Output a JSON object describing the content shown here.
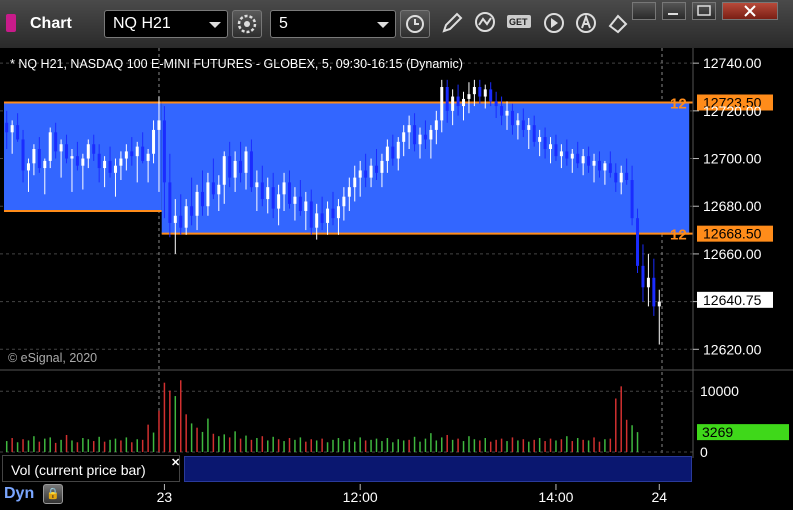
{
  "window": {
    "title": "Chart"
  },
  "toolbar": {
    "symbol": "NQ H21",
    "interval": "5",
    "icons": [
      "settings-gear-icon",
      "clock-icon",
      "pencil-draw-icon",
      "study-icon",
      "get-icon",
      "play-icon",
      "alert-icon",
      "cursor-icon"
    ],
    "window_controls": [
      "restore-icon",
      "minimize-icon",
      "maximize-icon",
      "close-icon"
    ]
  },
  "colors": {
    "background": "#000000",
    "zone_fill": "#3366ff",
    "zone_border": "#ff8c1a",
    "up_bar": "#ffffff",
    "down_bar": "#1a2cff",
    "vol_up": "#3fb83f",
    "vol_down": "#d23030",
    "last_price_bg": "#ffffff",
    "vol_last_bg": "#3fd81a"
  },
  "chart_data": {
    "type": "candlestick",
    "title": "* NQ H21, NASDAQ 100 E-MINI FUTURES - GLOBEX, 5, 09:30-16:15 (Dynamic)",
    "copyright": "© eSignal, 2020",
    "price_axis": {
      "ylim": [
        12613,
        12743
      ],
      "ticks": [
        12620.0,
        12640.0,
        12660.0,
        12680.0,
        12700.0,
        12720.0,
        12740.0
      ],
      "tick_labels": [
        "12620.00",
        "12640.00",
        "12660.00",
        "12680.00",
        "12700.00",
        "12720.00",
        "12740.00"
      ]
    },
    "x_axis": {
      "tick_labels": [
        "23",
        "12:00",
        "14:00",
        "24"
      ]
    },
    "zones": [
      {
        "upper": 12723.5,
        "lower": 12678.0,
        "start_bar": 0,
        "end_bar": 28
      },
      {
        "upper": 12723.5,
        "lower": 12668.5,
        "start_bar": 29,
        "end_bar": 125
      }
    ],
    "price_lines": [
      {
        "value": 12723.5,
        "label": "12723.50",
        "tag": "12"
      },
      {
        "value": 12668.5,
        "label": "12668.50",
        "tag": "12"
      }
    ],
    "last_price": {
      "value": 12640.75,
      "label": "12640.75"
    },
    "candles": [
      [
        12715,
        12720,
        12704,
        12711
      ],
      [
        12711,
        12716,
        12702,
        12714
      ],
      [
        12714,
        12719,
        12707,
        12708
      ],
      [
        12708,
        12712,
        12690,
        12695
      ],
      [
        12695,
        12700,
        12686,
        12698
      ],
      [
        12698,
        12706,
        12693,
        12704
      ],
      [
        12704,
        12709,
        12694,
        12696
      ],
      [
        12696,
        12700,
        12685,
        12699
      ],
      [
        12699,
        12713,
        12696,
        12711
      ],
      [
        12711,
        12715,
        12700,
        12703
      ],
      [
        12703,
        12708,
        12692,
        12706
      ],
      [
        12706,
        12710,
        12698,
        12700
      ],
      [
        12700,
        12704,
        12686,
        12701
      ],
      [
        12701,
        12707,
        12695,
        12697
      ],
      [
        12697,
        12702,
        12687,
        12700
      ],
      [
        12700,
        12708,
        12696,
        12706
      ],
      [
        12706,
        12710,
        12699,
        12702
      ],
      [
        12702,
        12706,
        12690,
        12696
      ],
      [
        12696,
        12701,
        12688,
        12699
      ],
      [
        12699,
        12705,
        12692,
        12694
      ],
      [
        12694,
        12700,
        12684,
        12697
      ],
      [
        12697,
        12703,
        12691,
        12700
      ],
      [
        12700,
        12706,
        12695,
        12703
      ],
      [
        12703,
        12709,
        12697,
        12701
      ],
      [
        12701,
        12707,
        12690,
        12705
      ],
      [
        12705,
        12711,
        12698,
        12699
      ],
      [
        12699,
        12704,
        12690,
        12702
      ],
      [
        12702,
        12716,
        12698,
        12712
      ],
      [
        12712,
        12726,
        12686,
        12716
      ],
      [
        12716,
        12722,
        12675,
        12690
      ],
      [
        12690,
        12702,
        12667,
        12673
      ],
      [
        12673,
        12683,
        12660,
        12676
      ],
      [
        12676,
        12685,
        12668,
        12671
      ],
      [
        12671,
        12683,
        12668,
        12680
      ],
      [
        12680,
        12692,
        12672,
        12676
      ],
      [
        12676,
        12689,
        12670,
        12686
      ],
      [
        12686,
        12695,
        12676,
        12680
      ],
      [
        12680,
        12694,
        12676,
        12690
      ],
      [
        12690,
        12700,
        12683,
        12685
      ],
      [
        12685,
        12693,
        12678,
        12689
      ],
      [
        12689,
        12703,
        12681,
        12701
      ],
      [
        12701,
        12707,
        12688,
        12692
      ],
      [
        12692,
        12703,
        12686,
        12699
      ],
      [
        12699,
        12707,
        12690,
        12694
      ],
      [
        12694,
        12705,
        12687,
        12703
      ],
      [
        12703,
        12708,
        12686,
        12688
      ],
      [
        12688,
        12695,
        12678,
        12690
      ],
      [
        12690,
        12697,
        12680,
        12683
      ],
      [
        12683,
        12692,
        12677,
        12688
      ],
      [
        12688,
        12694,
        12675,
        12679
      ],
      [
        12679,
        12689,
        12672,
        12685
      ],
      [
        12685,
        12694,
        12678,
        12690
      ],
      [
        12690,
        12695,
        12679,
        12681
      ],
      [
        12681,
        12688,
        12674,
        12684
      ],
      [
        12684,
        12691,
        12676,
        12678
      ],
      [
        12678,
        12686,
        12670,
        12682
      ],
      [
        12682,
        12687,
        12668,
        12671
      ],
      [
        12671,
        12681,
        12666,
        12677
      ],
      [
        12677,
        12684,
        12670,
        12673
      ],
      [
        12673,
        12682,
        12668,
        12679
      ],
      [
        12679,
        12686,
        12672,
        12675
      ],
      [
        12675,
        12683,
        12668,
        12680
      ],
      [
        12680,
        12688,
        12674,
        12684
      ],
      [
        12684,
        12692,
        12678,
        12688
      ],
      [
        12688,
        12697,
        12682,
        12692
      ],
      [
        12692,
        12699,
        12684,
        12695
      ],
      [
        12695,
        12702,
        12688,
        12692
      ],
      [
        12692,
        12700,
        12688,
        12697
      ],
      [
        12697,
        12704,
        12691,
        12694
      ],
      [
        12694,
        12702,
        12688,
        12699
      ],
      [
        12699,
        12708,
        12694,
        12705
      ],
      [
        12705,
        12710,
        12697,
        12700
      ],
      [
        12700,
        12709,
        12695,
        12707
      ],
      [
        12707,
        12714,
        12701,
        12711
      ],
      [
        12711,
        12718,
        12704,
        12714
      ],
      [
        12714,
        12719,
        12703,
        12706
      ],
      [
        12706,
        12713,
        12700,
        12710
      ],
      [
        12710,
        12716,
        12704,
        12708
      ],
      [
        12708,
        12714,
        12700,
        12712
      ],
      [
        12712,
        12720,
        12706,
        12716
      ],
      [
        12716,
        12733,
        12711,
        12730
      ],
      [
        12730,
        12733,
        12715,
        12720
      ],
      [
        12720,
        12729,
        12714,
        12726
      ],
      [
        12726,
        12731,
        12718,
        12722
      ],
      [
        12722,
        12728,
        12716,
        12725
      ],
      [
        12725,
        12732,
        12719,
        12727
      ],
      [
        12727,
        12733,
        12722,
        12730
      ],
      [
        12730,
        12733,
        12723,
        12726
      ],
      [
        12726,
        12731,
        12721,
        12729
      ],
      [
        12729,
        12732,
        12722,
        12724
      ],
      [
        12724,
        12728,
        12717,
        12722
      ],
      [
        12722,
        12726,
        12714,
        12718
      ],
      [
        12718,
        12724,
        12712,
        12720
      ],
      [
        12720,
        12723,
        12710,
        12714
      ],
      [
        12714,
        12719,
        12708,
        12716
      ],
      [
        12716,
        12721,
        12709,
        12712
      ],
      [
        12712,
        12717,
        12704,
        12714
      ],
      [
        12714,
        12718,
        12705,
        12707
      ],
      [
        12707,
        12712,
        12701,
        12709
      ],
      [
        12709,
        12713,
        12700,
        12704
      ],
      [
        12704,
        12709,
        12698,
        12706
      ],
      [
        12706,
        12710,
        12699,
        12701
      ],
      [
        12701,
        12706,
        12696,
        12703
      ],
      [
        12703,
        12708,
        12697,
        12700
      ],
      [
        12700,
        12704,
        12694,
        12702
      ],
      [
        12702,
        12707,
        12696,
        12698
      ],
      [
        12698,
        12704,
        12693,
        12701
      ],
      [
        12701,
        12705,
        12694,
        12697
      ],
      [
        12697,
        12702,
        12690,
        12699
      ],
      [
        12699,
        12703,
        12692,
        12695
      ],
      [
        12695,
        12699,
        12689,
        12698
      ],
      [
        12698,
        12703,
        12692,
        12694
      ],
      [
        12694,
        12698,
        12686,
        12690
      ],
      [
        12690,
        12697,
        12685,
        12694
      ],
      [
        12694,
        12700,
        12689,
        12691
      ],
      [
        12691,
        12697,
        12672,
        12675
      ],
      [
        12675,
        12679,
        12652,
        12655
      ],
      [
        12655,
        12664,
        12640,
        12646
      ],
      [
        12646,
        12660,
        12638,
        12650
      ],
      [
        12650,
        12658,
        12634,
        12638
      ],
      [
        12638,
        12645,
        12622,
        12640
      ]
    ],
    "volume": {
      "ylim": [
        0,
        12500
      ],
      "ticks": [
        0,
        10000
      ],
      "tick_labels": [
        "0",
        "10000"
      ],
      "label": "Vol (current price bar)",
      "last": {
        "value": 3269,
        "label": "3269"
      },
      "values": [
        1800,
        2300,
        1600,
        2100,
        1900,
        2600,
        1700,
        2200,
        2400,
        1500,
        2000,
        2800,
        1900,
        1600,
        2300,
        2100,
        1800,
        2500,
        1700,
        2000,
        2200,
        1900,
        2400,
        1600,
        2100,
        2000,
        4500,
        3200,
        6800,
        11400,
        10100,
        9200,
        11800,
        6200,
        4700,
        4000,
        3300,
        5500,
        3000,
        2600,
        2900,
        2400,
        3400,
        2200,
        2700,
        2000,
        2300,
        2600,
        1900,
        2500,
        2100,
        1800,
        2300,
        2000,
        2400,
        1700,
        2100,
        1900,
        2200,
        1600,
        2000,
        2300,
        1800,
        2100,
        1700,
        2400,
        1900,
        2000,
        2200,
        1800,
        2300,
        1600,
        2100,
        1900,
        2000,
        2500,
        1700,
        2200,
        3100,
        1900,
        2400,
        2800,
        2000,
        2200,
        1800,
        2600,
        2100,
        1900,
        2300,
        1700,
        2000,
        2200,
        1800,
        2400,
        1900,
        2100,
        1700,
        2000,
        2300,
        1800,
        2200,
        1900,
        2100,
        2600,
        1800,
        2300,
        2000,
        1900,
        2400,
        1700,
        2100,
        2200,
        8800,
        10800,
        5300,
        4400,
        3269
      ],
      "up": [
        1,
        0,
        1,
        0,
        1,
        1,
        0,
        1,
        1,
        0,
        1,
        0,
        1,
        0,
        1,
        1,
        0,
        1,
        0,
        1,
        1,
        0,
        1,
        0,
        1,
        0,
        0,
        1,
        0,
        0,
        0,
        1,
        0,
        0,
        1,
        0,
        1,
        1,
        0,
        1,
        1,
        0,
        1,
        0,
        1,
        0,
        1,
        0,
        1,
        1,
        0,
        1,
        0,
        1,
        1,
        0,
        0,
        1,
        0,
        1,
        1,
        1,
        1,
        1,
        1,
        1,
        0,
        1,
        1,
        1,
        1,
        1,
        1,
        1,
        0,
        1,
        1,
        1,
        1,
        1,
        1,
        0,
        1,
        0,
        1,
        1,
        1,
        0,
        1,
        0,
        0,
        0,
        1,
        0,
        1,
        0,
        1,
        0,
        1,
        0,
        0,
        1,
        0,
        1,
        0,
        1,
        0,
        1,
        0,
        0,
        1,
        0,
        0,
        0,
        0,
        1,
        1
      ]
    }
  }
}
